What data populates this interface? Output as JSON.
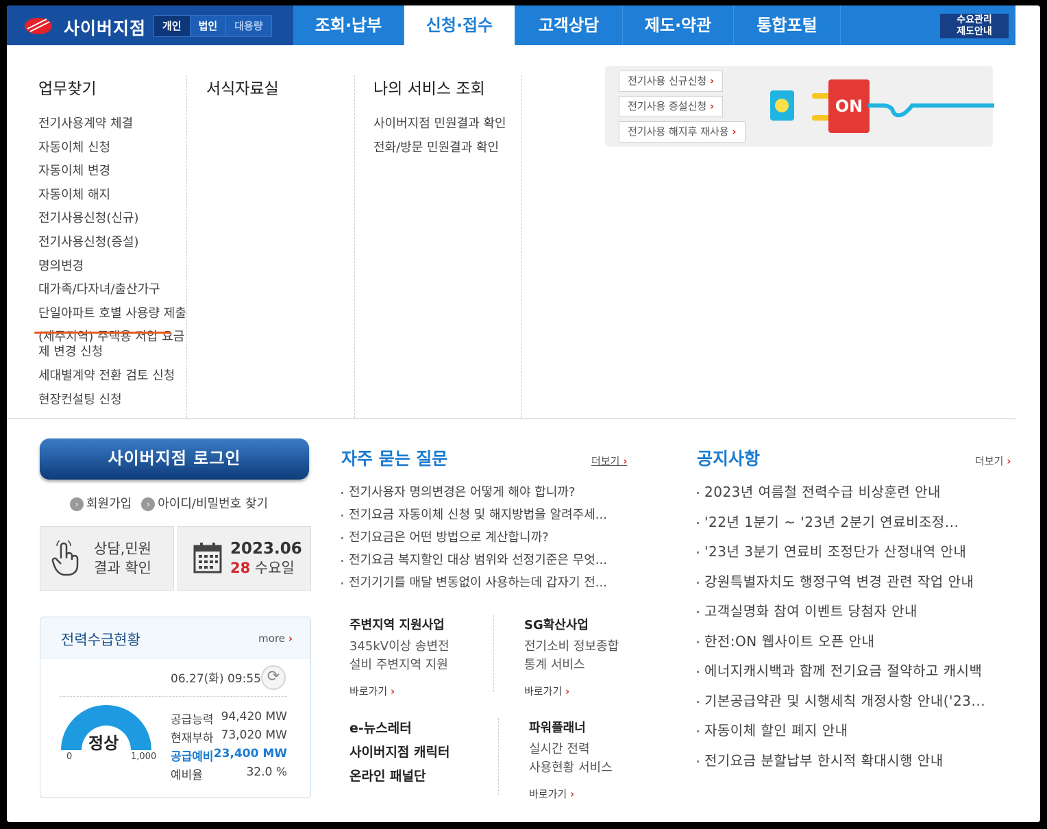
{
  "brand": {
    "title": "사이버지점",
    "seg": [
      "개인",
      "법인",
      "대용량"
    ]
  },
  "nav": {
    "tabs": [
      "조회·납부",
      "신청·접수",
      "고객상담",
      "제도·약관",
      "통합포털"
    ],
    "right_btn_l1": "수요관리",
    "right_btn_l2": "제도안내"
  },
  "dropdown": {
    "col1": {
      "title": "업무찾기",
      "items": [
        "전기사용계약 체결",
        "자동이체 신청",
        "자동이체 변경",
        "자동이체 해지",
        "전기사용신청(신규)",
        "전기사용신청(증설)",
        "명의변경",
        "대가족/다자녀/출산가구",
        "단일아파트 호별 사용량 제출",
        "(제주지역) 주택용 저압 요금",
        "제 변경 신청",
        "세대별계약 전환 검토 신청",
        "현장컨설팅 신청"
      ]
    },
    "col2": {
      "title": "서식자료실"
    },
    "col3": {
      "title": "나의 서비스 조회",
      "items": [
        "사이버지점 민원결과 확인",
        "전화/방문 민원결과 확인"
      ]
    },
    "banner": {
      "btn1": "전기사용 신규신청",
      "btn2": "전기사용 증설신청",
      "btn3": "전기사용 해지후 재사용",
      "plug": "ON",
      "arrow": "›"
    }
  },
  "login": {
    "button": "사이버지점 로그인",
    "join": "회원가입",
    "find": "아이디/비밀번호 찾기",
    "bullet": "›"
  },
  "consult": {
    "l1": "상담,민원",
    "l2": "결과 확인"
  },
  "calendar": {
    "ym": "2023.06",
    "day": "28",
    "weekday": "수요일"
  },
  "power": {
    "title": "전력수급현황",
    "more": "more",
    "arrow": "›",
    "timestamp": "06.27(화) 09:55",
    "refresh": "⟳",
    "gauge_label": "정상",
    "gauge_min": "0",
    "gauge_max": "1,000",
    "rows": [
      {
        "label": "공급능력",
        "value": "94,420 MW"
      },
      {
        "label": "현재부하",
        "value": "73,020 MW"
      },
      {
        "label": "공급예비",
        "value": "23,400 MW"
      },
      {
        "label": "예비율",
        "value": "32.0 %"
      }
    ]
  },
  "faq": {
    "title": "자주 묻는 질문",
    "more": "더보기",
    "arrow": "›",
    "items": [
      "전기사용자 명의변경은 어떻게 해야 합니까?",
      "전기요금 자동이체 신청 및 해지방법을 알려주세...",
      "전기요금은 어떤 방법으로 계산합니까?",
      "전기요금 복지할인 대상 범위와 선정기준은 무엇...",
      "전기기기를 매달 변동없이 사용하는데 갑자기 전..."
    ]
  },
  "services": {
    "s1": {
      "title": "주변지역 지원사업",
      "l1": "345kV이상 송변전",
      "l2": "설비 주변지역 지원",
      "go": "바로가기"
    },
    "s2": {
      "title": "SG확산사업",
      "l1": "전기소비 정보종합",
      "l2": "통계 서비스",
      "go": "바로가기"
    },
    "s3": [
      "e-뉴스레터",
      "사이버지점 캐릭터",
      "온라인 패널단"
    ],
    "s4": {
      "title": "파워플래너",
      "l1": "실시간 전력",
      "l2": "사용현황 서비스",
      "go": "바로가기"
    },
    "arrow": "›"
  },
  "notice": {
    "title": "공지사항",
    "more": "더보기",
    "arrow": "›",
    "items": [
      "2023년 여름철 전력수급 비상훈련 안내",
      "'22년 1분기 ~ '23년 2분기 연료비조정...",
      "'23년 3분기 연료비 조정단가 산정내역 안내",
      "강원특별자치도 행정구역 변경 관련 작업 안내",
      "고객실명화 참여 이벤트 당첨자 안내",
      "한전:ON 웹사이트 오픈 안내",
      "에너지캐시백과 함께 전기요금 절약하고 캐시백",
      "기본공급약관 및 시행세칙 개정사항 안내('23...",
      "자동이체 할인 폐지 안내",
      "전기요금 분할납부 한시적 확대시행 안내"
    ]
  },
  "colors": {
    "nav": "#1f7fd6",
    "brand": "#174fa0",
    "accent": "#d3262c",
    "underline": "#e85a1a"
  }
}
